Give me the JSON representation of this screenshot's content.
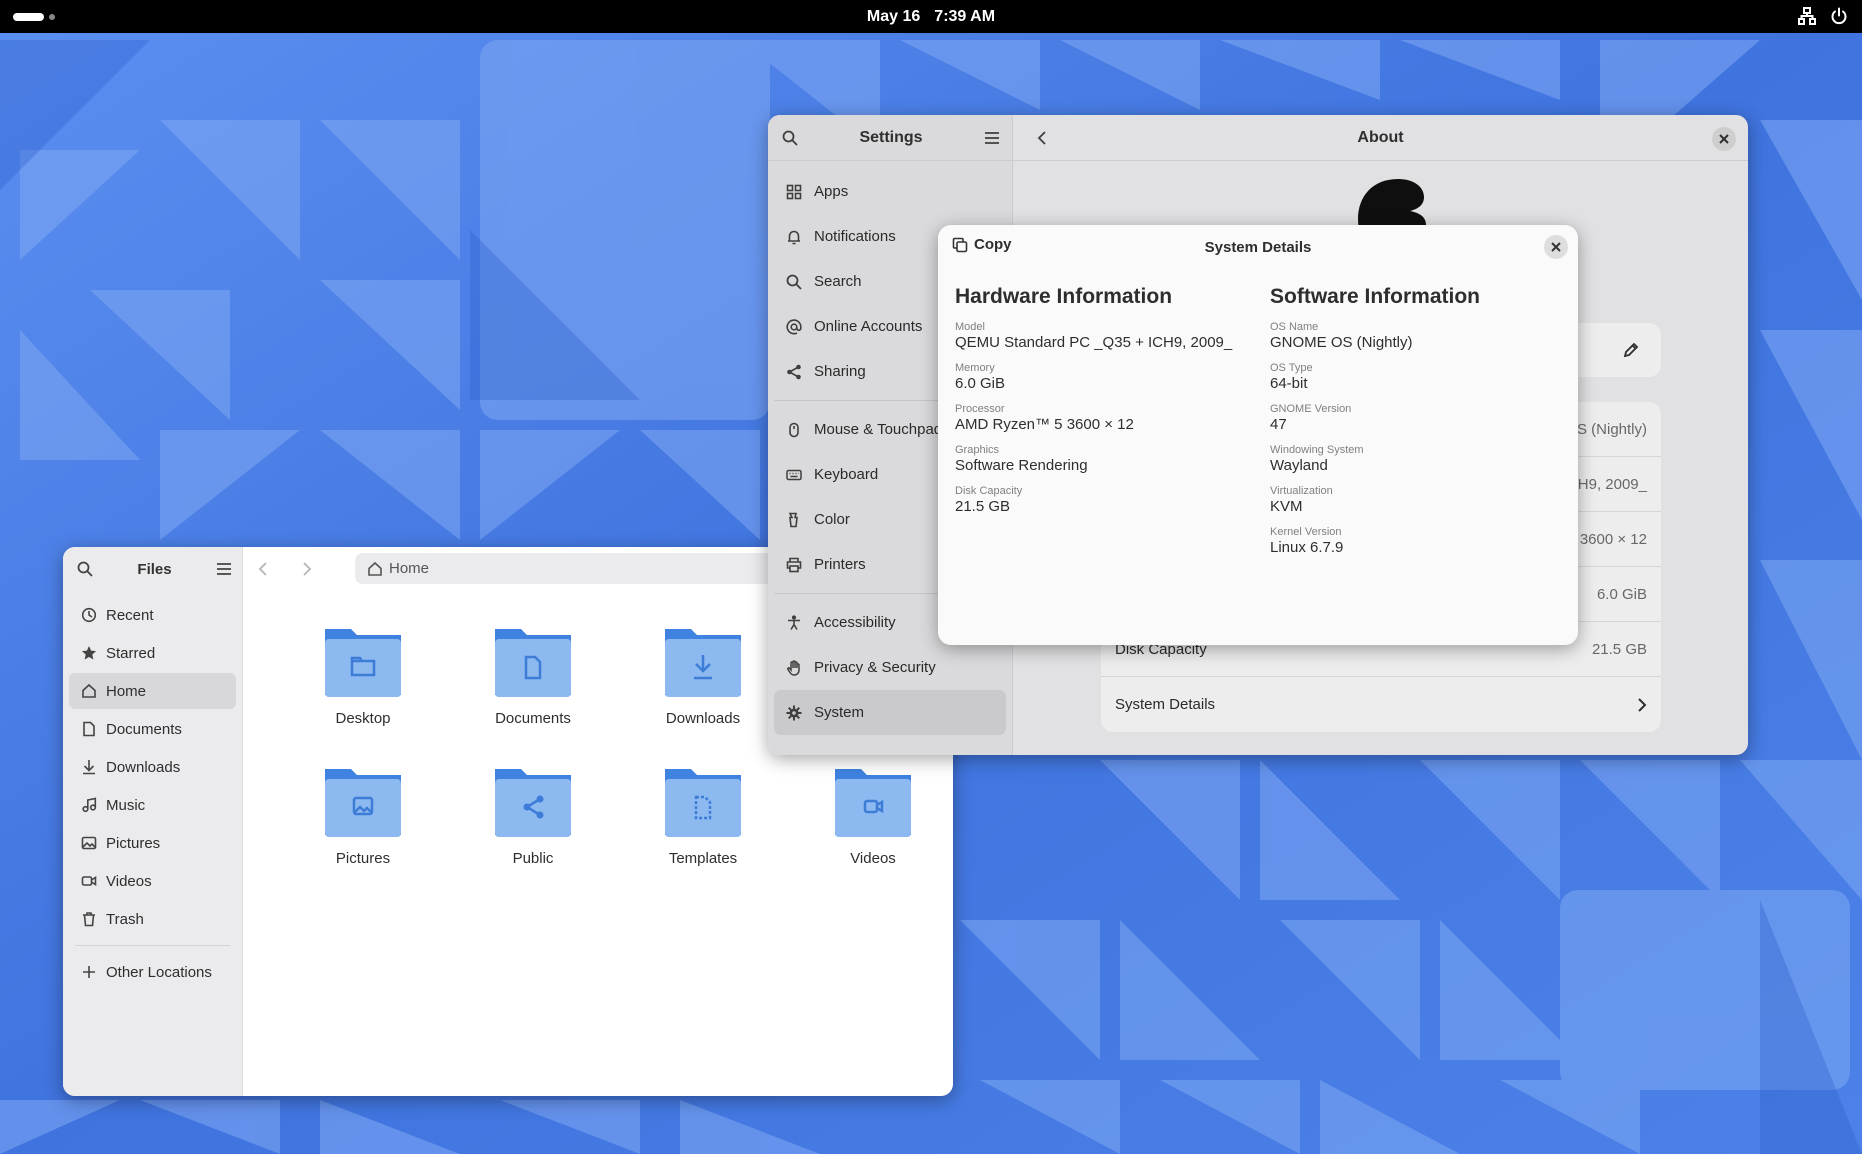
{
  "topbar": {
    "date": "May 16",
    "time": "7:39 AM",
    "icons": [
      "network-icon",
      "power-icon"
    ]
  },
  "files": {
    "title": "Files",
    "path": "Home",
    "sidebar": [
      {
        "label": "Recent",
        "icon": "clock-icon"
      },
      {
        "label": "Starred",
        "icon": "star-icon"
      },
      {
        "label": "Home",
        "icon": "home-icon",
        "active": true
      },
      {
        "label": "Documents",
        "icon": "document-icon"
      },
      {
        "label": "Downloads",
        "icon": "download-icon"
      },
      {
        "label": "Music",
        "icon": "music-icon"
      },
      {
        "label": "Pictures",
        "icon": "picture-icon"
      },
      {
        "label": "Videos",
        "icon": "video-icon"
      },
      {
        "label": "Trash",
        "icon": "trash-icon"
      }
    ],
    "other_locations": "Other Locations",
    "folders": [
      {
        "label": "Desktop",
        "icon": "folder-desktop-icon"
      },
      {
        "label": "Documents",
        "icon": "folder-documents-icon"
      },
      {
        "label": "Downloads",
        "icon": "folder-downloads-icon"
      },
      {
        "label": "Pictures",
        "icon": "folder-pictures-icon"
      },
      {
        "label": "Public",
        "icon": "folder-public-icon"
      },
      {
        "label": "Templates",
        "icon": "folder-templates-icon"
      },
      {
        "label": "Videos",
        "icon": "folder-videos-icon"
      }
    ]
  },
  "settings": {
    "title": "Settings",
    "page_title": "About",
    "sidebar": [
      {
        "label": "Apps",
        "icon": "apps-icon"
      },
      {
        "label": "Notifications",
        "icon": "bell-icon"
      },
      {
        "label": "Search",
        "icon": "search-icon"
      },
      {
        "label": "Online Accounts",
        "icon": "at-icon"
      },
      {
        "label": "Sharing",
        "icon": "share-icon"
      },
      {
        "label": "Mouse & Touchpad",
        "icon": "mouse-icon"
      },
      {
        "label": "Keyboard",
        "icon": "keyboard-icon"
      },
      {
        "label": "Color",
        "icon": "color-icon"
      },
      {
        "label": "Printers",
        "icon": "printer-icon"
      },
      {
        "label": "Accessibility",
        "icon": "accessibility-icon"
      },
      {
        "label": "Privacy & Security",
        "icon": "hand-icon"
      },
      {
        "label": "System",
        "icon": "gear-icon",
        "active": true
      }
    ],
    "about_rows": [
      {
        "label": "",
        "value": "OS (Nightly)"
      },
      {
        "label": "",
        "value": "ICH9, 2009_"
      },
      {
        "label": "",
        "value": "3600 × 12"
      },
      {
        "label": "",
        "value": "6.0 GiB"
      },
      {
        "label": "Disk Capacity",
        "value": "21.5 GB"
      }
    ],
    "system_details_label": "System Details"
  },
  "dialog": {
    "title": "System Details",
    "copy_label": "Copy",
    "hardware": {
      "heading": "Hardware Information",
      "fields": [
        {
          "label": "Model",
          "value": "QEMU Standard PC _Q35 + ICH9, 2009_"
        },
        {
          "label": "Memory",
          "value": "6.0 GiB"
        },
        {
          "label": "Processor",
          "value": "AMD Ryzen™ 5 3600 × 12"
        },
        {
          "label": "Graphics",
          "value": "Software Rendering"
        },
        {
          "label": "Disk Capacity",
          "value": "21.5 GB"
        }
      ]
    },
    "software": {
      "heading": "Software Information",
      "fields": [
        {
          "label": "OS Name",
          "value": "GNOME OS (Nightly)"
        },
        {
          "label": "OS Type",
          "value": "64-bit"
        },
        {
          "label": "GNOME Version",
          "value": "47"
        },
        {
          "label": "Windowing System",
          "value": "Wayland"
        },
        {
          "label": "Virtualization",
          "value": "KVM"
        },
        {
          "label": "Kernel Version",
          "value": "Linux 6.7.9"
        }
      ]
    }
  },
  "colors": {
    "wallpaper": "#4a7ee6",
    "folder": "#5a9ae6",
    "folder_icon": "#3d7dd8"
  }
}
